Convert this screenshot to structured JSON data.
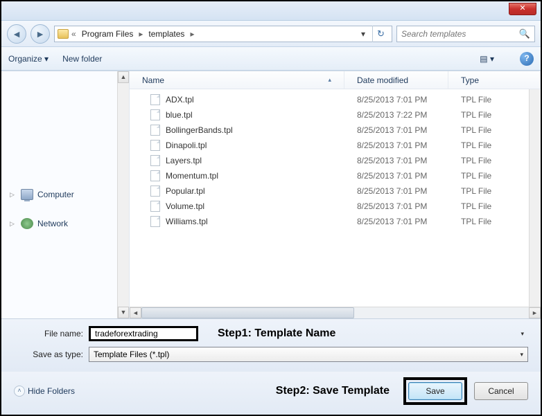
{
  "titlebar": {
    "close_glyph": "✕"
  },
  "nav": {
    "back_glyph": "◄",
    "forward_glyph": "►",
    "breadcrumb": {
      "sep_left": "«",
      "item1": "Program Files",
      "sep": "▸",
      "item2": "templates",
      "dropdown_glyph": "▾",
      "refresh_glyph": "↻"
    },
    "search_placeholder": "Search templates",
    "search_glyph": "🔍"
  },
  "toolbar": {
    "organize": "Organize ▾",
    "new_folder": "New folder",
    "view_glyph": "▤ ▾",
    "help_glyph": "?"
  },
  "tree": {
    "computer": "Computer",
    "network": "Network",
    "expand_glyph": "▷"
  },
  "columns": {
    "name": "Name",
    "sort_glyph": "▴",
    "date": "Date modified",
    "type": "Type"
  },
  "files": [
    {
      "name": "ADX.tpl",
      "date": "8/25/2013 7:01 PM",
      "type": "TPL File"
    },
    {
      "name": "blue.tpl",
      "date": "8/25/2013 7:22 PM",
      "type": "TPL File"
    },
    {
      "name": "BollingerBands.tpl",
      "date": "8/25/2013 7:01 PM",
      "type": "TPL File"
    },
    {
      "name": "Dinapoli.tpl",
      "date": "8/25/2013 7:01 PM",
      "type": "TPL File"
    },
    {
      "name": "Layers.tpl",
      "date": "8/25/2013 7:01 PM",
      "type": "TPL File"
    },
    {
      "name": "Momentum.tpl",
      "date": "8/25/2013 7:01 PM",
      "type": "TPL File"
    },
    {
      "name": "Popular.tpl",
      "date": "8/25/2013 7:01 PM",
      "type": "TPL File"
    },
    {
      "name": "Volume.tpl",
      "date": "8/25/2013 7:01 PM",
      "type": "TPL File"
    },
    {
      "name": "Williams.tpl",
      "date": "8/25/2013 7:01 PM",
      "type": "TPL File"
    }
  ],
  "form": {
    "file_name_label": "File name:",
    "file_name_value": "tradeforextrading",
    "save_as_type_label": "Save as type:",
    "save_as_type_value": "Template Files (*.tpl)",
    "dd_glyph": "▾"
  },
  "annotations": {
    "step1": "Step1: Template Name",
    "step2": "Step2: Save Template"
  },
  "footer": {
    "hide_folders": "Hide Folders",
    "chev_glyph": "˄",
    "save": "Save",
    "cancel": "Cancel"
  },
  "scroll": {
    "up": "▲",
    "down": "▼",
    "left": "◄",
    "right": "►",
    "track": "≡"
  }
}
